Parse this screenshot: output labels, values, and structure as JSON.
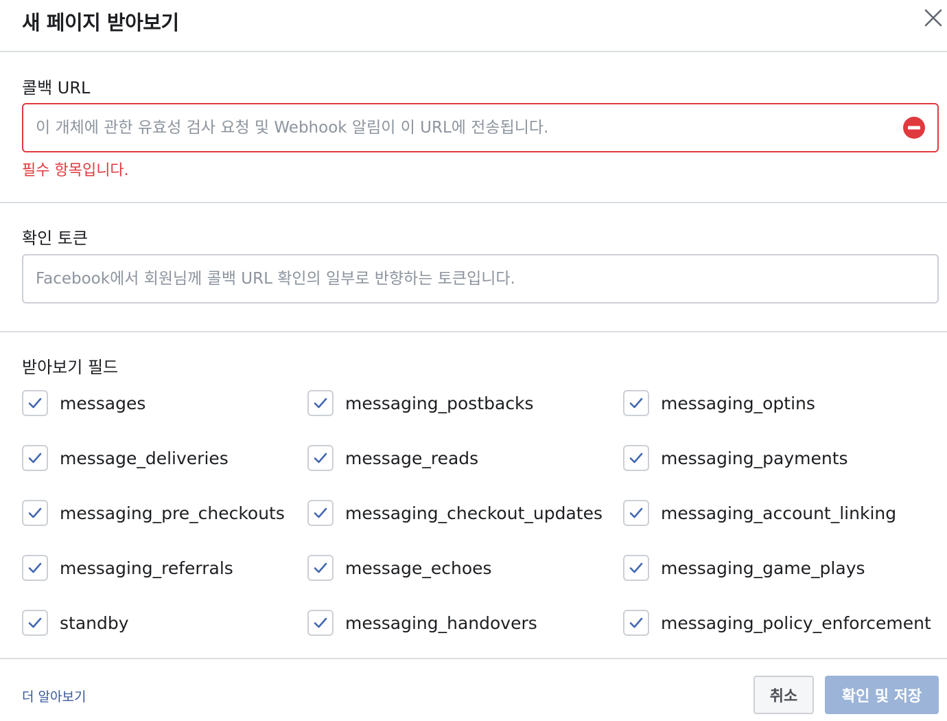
{
  "dialog": {
    "title": "새 페이지 받아보기"
  },
  "callback": {
    "label": "콜백 URL",
    "value": "",
    "placeholder": "이 개체에 관한 유효성 검사 요청 및 Webhook 알림이 이 URL에 전송됩니다.",
    "error": "필수 항목입니다."
  },
  "verify": {
    "label": "확인 토큰",
    "value": "",
    "placeholder": "Facebook에서 회원님께 콜백 URL 확인의 일부로 반향하는 토큰입니다."
  },
  "fields": {
    "label": "받아보기 필드",
    "items": [
      {
        "label": "messages",
        "checked": true
      },
      {
        "label": "messaging_postbacks",
        "checked": true
      },
      {
        "label": "messaging_optins",
        "checked": true
      },
      {
        "label": "message_deliveries",
        "checked": true
      },
      {
        "label": "message_reads",
        "checked": true
      },
      {
        "label": "messaging_payments",
        "checked": true
      },
      {
        "label": "messaging_pre_checkouts",
        "checked": true
      },
      {
        "label": "messaging_checkout_updates",
        "checked": true
      },
      {
        "label": "messaging_account_linking",
        "checked": true
      },
      {
        "label": "messaging_referrals",
        "checked": true
      },
      {
        "label": "message_echoes",
        "checked": true
      },
      {
        "label": "messaging_game_plays",
        "checked": true
      },
      {
        "label": "standby",
        "checked": true
      },
      {
        "label": "messaging_handovers",
        "checked": true
      },
      {
        "label": "messaging_policy_enforcement",
        "checked": true
      }
    ]
  },
  "footer": {
    "learn_more": "더 알아보기",
    "cancel": "취소",
    "confirm": "확인 및 저장"
  },
  "colors": {
    "error": "#e0393e",
    "accent": "#4267b2",
    "confirm_disabled": "#9cb4d8",
    "link": "#385898"
  },
  "icons": {
    "close": "close-icon",
    "error": "error-icon",
    "check": "checkmark-icon"
  }
}
